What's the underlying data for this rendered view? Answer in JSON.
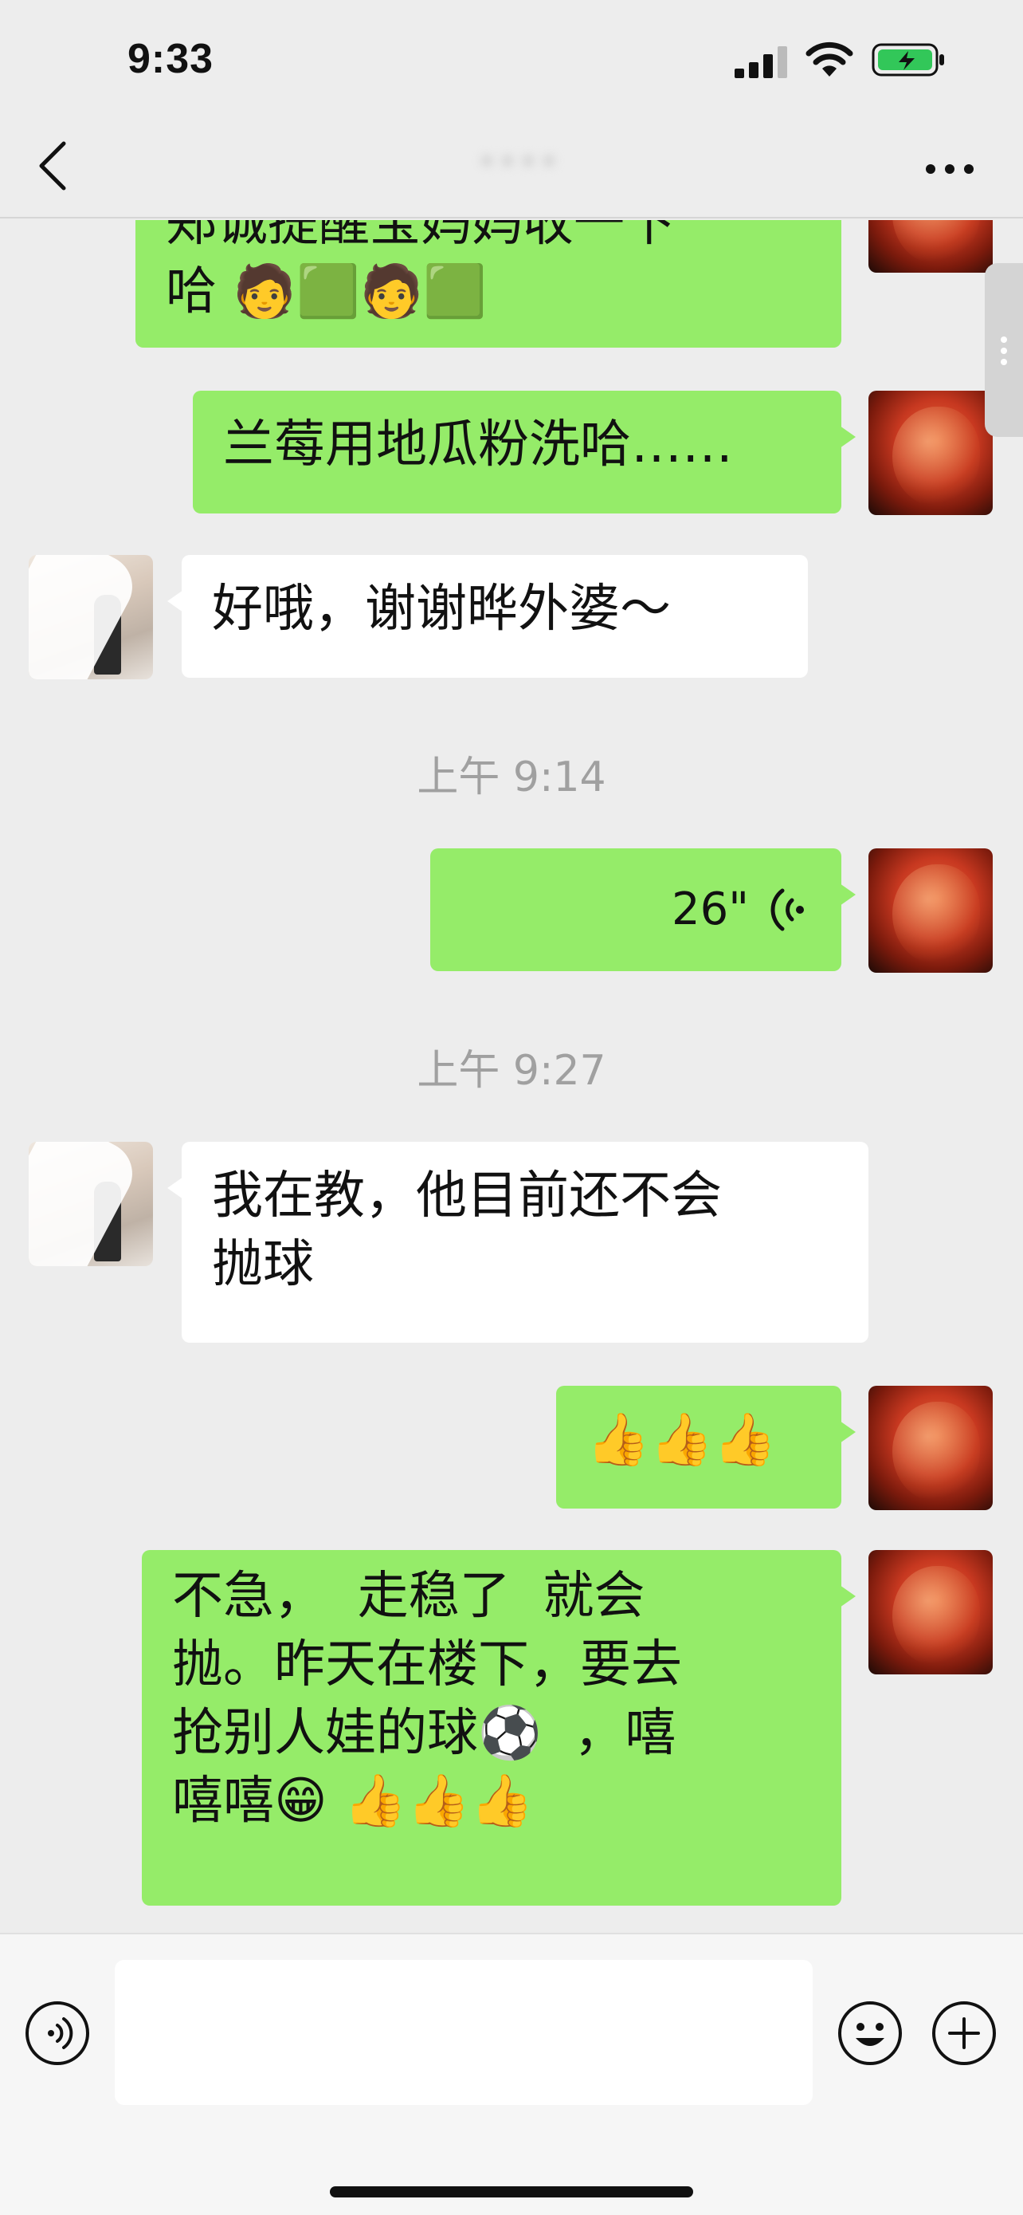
{
  "status_bar": {
    "time": "9:33"
  },
  "nav": {
    "contact_name": "••••"
  },
  "messages": [
    {
      "id": "m1",
      "side": "right",
      "text": "郑诚提醒宝妈妈收一下\n哈 🧑‍🟩🧑‍🟩"
    },
    {
      "id": "m2",
      "side": "right",
      "text": "兰莓用地瓜粉洗哈……"
    },
    {
      "id": "m3",
      "side": "left",
      "text": "好哦，谢谢晔外婆～"
    },
    {
      "id": "t1",
      "type": "timestamp",
      "text": "上午 9:14"
    },
    {
      "id": "m4",
      "side": "right",
      "type": "voice",
      "duration": "26\""
    },
    {
      "id": "t2",
      "type": "timestamp",
      "text": "上午 9:27"
    },
    {
      "id": "m5",
      "side": "left",
      "text": "我在教，他目前还不会\n抛球"
    },
    {
      "id": "m6",
      "side": "right",
      "text": "👍👍👍"
    },
    {
      "id": "m7",
      "side": "right",
      "text": "不急，  走稳了  就会\n抛。昨天在楼下，要去\n抢别人娃的球⚽  ，嘻\n嘻嘻😁 👍👍👍"
    }
  ],
  "input": {
    "value": ""
  },
  "colors": {
    "bubble_green": "#95ec69",
    "background": "#ededed",
    "bubble_white": "#ffffff"
  },
  "icons": [
    "back-icon",
    "more-icon",
    "voice-icon",
    "emoji-icon",
    "plus-icon",
    "signal-icon",
    "wifi-icon",
    "battery-icon"
  ]
}
